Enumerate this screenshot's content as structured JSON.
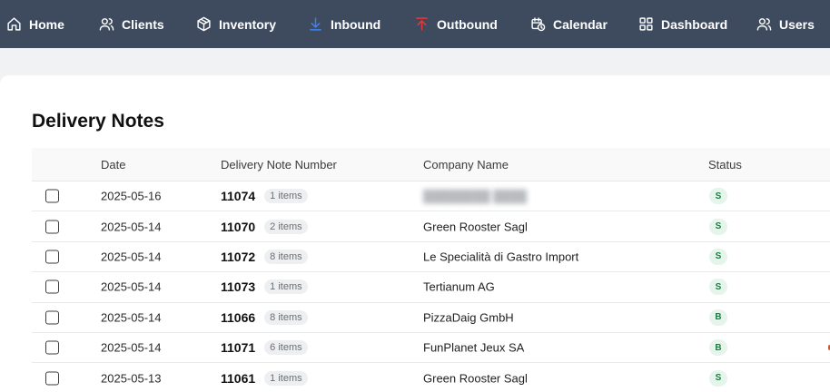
{
  "nav": {
    "items": [
      {
        "label": "Home",
        "icon": "home-icon"
      },
      {
        "label": "Clients",
        "icon": "users-icon"
      },
      {
        "label": "Inventory",
        "icon": "package-icon"
      },
      {
        "label": "Inbound",
        "icon": "arrow-down-icon",
        "color": "#3b82f6"
      },
      {
        "label": "Outbound",
        "icon": "arrow-up-icon",
        "color": "#e23a3a"
      },
      {
        "label": "Calendar",
        "icon": "calendar-icon"
      },
      {
        "label": "Dashboard",
        "icon": "grid-icon"
      },
      {
        "label": "Users",
        "icon": "users-icon"
      }
    ]
  },
  "page": {
    "title": "Delivery Notes"
  },
  "table": {
    "columns": {
      "date": "Date",
      "number": "Delivery Note Number",
      "company": "Company Name",
      "status": "Status"
    },
    "rows": [
      {
        "date": "2025-05-16",
        "number": "11074",
        "items": "1 items",
        "company": "",
        "status": "S"
      },
      {
        "date": "2025-05-14",
        "number": "11070",
        "items": "2 items",
        "company": "Green Rooster Sagl",
        "status": "S"
      },
      {
        "date": "2025-05-14",
        "number": "11072",
        "items": "8 items",
        "company": "Le Specialità di Gastro Import",
        "status": "S"
      },
      {
        "date": "2025-05-14",
        "number": "11073",
        "items": "1 items",
        "company": "Tertianum AG",
        "status": "S"
      },
      {
        "date": "2025-05-14",
        "number": "11066",
        "items": "8 items",
        "company": "PizzaDaig GmbH",
        "status": "B"
      },
      {
        "date": "2025-05-14",
        "number": "11071",
        "items": "6 items",
        "company": "FunPlanet Jeux SA",
        "status": "B"
      },
      {
        "date": "2025-05-13",
        "number": "11061",
        "items": "1 items",
        "company": "Green Rooster Sagl",
        "status": "S"
      }
    ]
  },
  "colors": {
    "nav_bg": "#3e4b5f",
    "status_bg": "#e5f5ec",
    "status_text": "#17803d"
  }
}
